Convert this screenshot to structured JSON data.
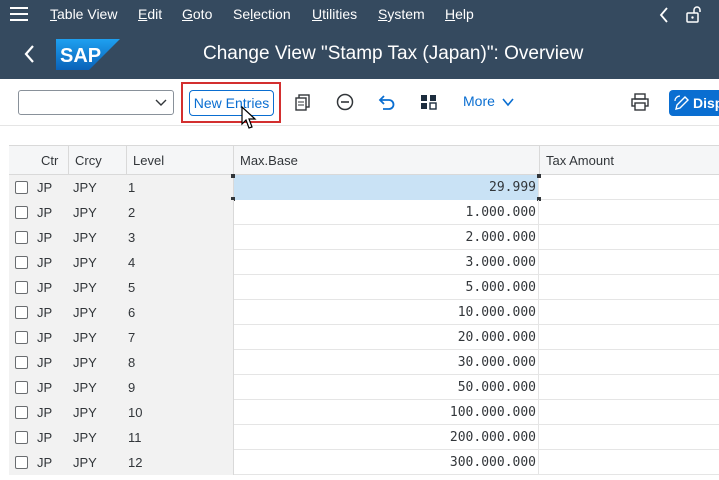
{
  "menu": {
    "items": [
      {
        "label": "Table View",
        "underline": "T"
      },
      {
        "label": "Edit",
        "underline": "E"
      },
      {
        "label": "Goto",
        "underline": "G"
      },
      {
        "label": "Selection",
        "underline": "l"
      },
      {
        "label": "Utilities",
        "underline": "U"
      },
      {
        "label": "System",
        "underline": "S"
      },
      {
        "label": "Help",
        "underline": "H"
      }
    ]
  },
  "header": {
    "logo_text": "SAP",
    "title": "Change View \"Stamp Tax (Japan)\": Overview"
  },
  "toolbar": {
    "dropdown_value": "",
    "new_entries_label": "New Entries",
    "more_label": "More",
    "display_label": "Disp"
  },
  "table": {
    "columns": [
      "Ctr",
      "Crcy",
      "Level",
      "Max.Base",
      "Tax Amount"
    ],
    "rows": [
      {
        "ctr": "JP",
        "crcy": "JPY",
        "level": "1",
        "max_base": "29.999",
        "tax_amount": ""
      },
      {
        "ctr": "JP",
        "crcy": "JPY",
        "level": "2",
        "max_base": "1.000.000",
        "tax_amount": ""
      },
      {
        "ctr": "JP",
        "crcy": "JPY",
        "level": "3",
        "max_base": "2.000.000",
        "tax_amount": ""
      },
      {
        "ctr": "JP",
        "crcy": "JPY",
        "level": "4",
        "max_base": "3.000.000",
        "tax_amount": ""
      },
      {
        "ctr": "JP",
        "crcy": "JPY",
        "level": "5",
        "max_base": "5.000.000",
        "tax_amount": ""
      },
      {
        "ctr": "JP",
        "crcy": "JPY",
        "level": "6",
        "max_base": "10.000.000",
        "tax_amount": ""
      },
      {
        "ctr": "JP",
        "crcy": "JPY",
        "level": "7",
        "max_base": "20.000.000",
        "tax_amount": ""
      },
      {
        "ctr": "JP",
        "crcy": "JPY",
        "level": "8",
        "max_base": "30.000.000",
        "tax_amount": ""
      },
      {
        "ctr": "JP",
        "crcy": "JPY",
        "level": "9",
        "max_base": "50.000.000",
        "tax_amount": ""
      },
      {
        "ctr": "JP",
        "crcy": "JPY",
        "level": "10",
        "max_base": "100.000.000",
        "tax_amount": ""
      },
      {
        "ctr": "JP",
        "crcy": "JPY",
        "level": "11",
        "max_base": "200.000.000",
        "tax_amount": ""
      },
      {
        "ctr": "JP",
        "crcy": "JPY",
        "level": "12",
        "max_base": "300.000.000",
        "tax_amount": ""
      }
    ]
  },
  "colors": {
    "shell": "#354a5f",
    "accent": "#0a6ed1",
    "highlight": "#d32f2f",
    "selection": "#c9e2f5"
  }
}
